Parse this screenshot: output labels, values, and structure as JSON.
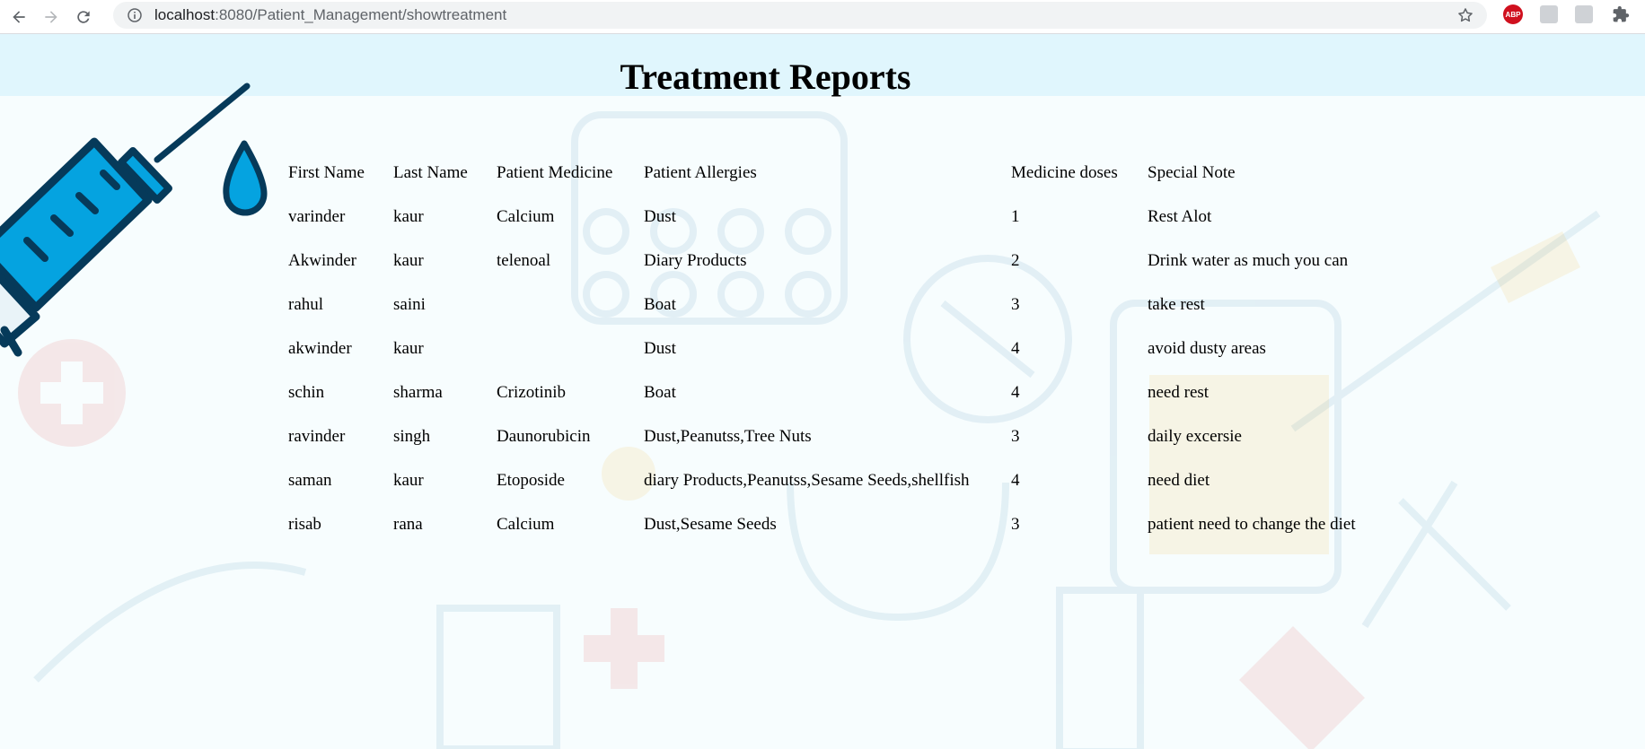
{
  "browser": {
    "url_host": "localhost",
    "url_path": ":8080/Patient_Management/showtreatment",
    "extensions": [
      "abp-icon",
      "extension-icon",
      "extension-icon",
      "puzzle-icon"
    ],
    "abp_label": "ABP"
  },
  "page": {
    "title": "Treatment Reports",
    "table": {
      "columns": [
        "First Name",
        "Last Name",
        "Patient Medicine",
        "Patient Allergies",
        "Medicine doses",
        "Special Note"
      ],
      "rows": [
        [
          "varinder",
          "kaur",
          "Calcium",
          "Dust",
          "1",
          "Rest Alot"
        ],
        [
          "Akwinder",
          "kaur",
          "telenoal",
          "Diary Products",
          "2",
          "Drink water as much you can"
        ],
        [
          "rahul",
          "saini",
          "",
          "Boat",
          "3",
          "take rest"
        ],
        [
          "akwinder",
          "kaur",
          "",
          "Dust",
          "4",
          "avoid dusty areas"
        ],
        [
          "schin",
          "sharma",
          "Crizotinib",
          "Boat",
          "4",
          "need rest"
        ],
        [
          "ravinder",
          "singh",
          "Daunorubicin",
          "Dust,Peanutss,Tree Nuts",
          "3",
          "daily excersie"
        ],
        [
          "saman",
          "kaur",
          "Etoposide",
          "diary Products,Peanutss,Sesame Seeds,shellfish",
          "4",
          "need diet"
        ],
        [
          "risab",
          "rana",
          "Calcium",
          "Dust,Sesame Seeds",
          "3",
          "patient need to change the diet"
        ]
      ]
    }
  },
  "colors": {
    "header_band": "#e0f6fd",
    "page_bg": "#f7fdfe",
    "syringe_blue": "#05a3e0",
    "syringe_dark": "#063a5a"
  }
}
